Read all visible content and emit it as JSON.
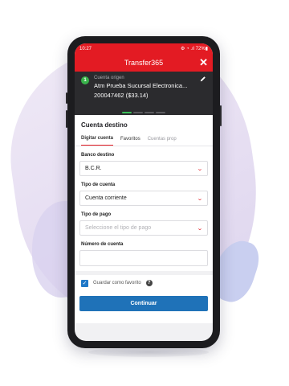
{
  "status_bar": {
    "time": "10:27",
    "icons": "⚙ ◔ .ıl 72%▮"
  },
  "header": {
    "title": "Transfer365",
    "close_label": "✕"
  },
  "origin": {
    "step_number": "1",
    "label": "Cuenta origen",
    "account_name": "Atm Prueba Sucursal Electronica...",
    "account_number": "200047462 ($33.14)"
  },
  "destination": {
    "section_title": "Cuenta destino",
    "tabs": [
      {
        "label": "Digitar cuenta"
      },
      {
        "label": "Favoritos"
      },
      {
        "label": "Cuentas prop"
      }
    ]
  },
  "form": {
    "bank": {
      "label": "Banco destino",
      "value": "B.C.R."
    },
    "account_type": {
      "label": "Tipo de cuenta",
      "value": "Cuenta corriente"
    },
    "payment_type": {
      "label": "Tipo de pago",
      "placeholder": "Seleccione el tipo de pago"
    },
    "account_number": {
      "label": "Número de cuenta",
      "value": ""
    }
  },
  "favorite": {
    "label": "Guardar como favorito",
    "checked": true,
    "help_icon": "?"
  },
  "footer": {
    "continue_label": "Continuar"
  },
  "colors": {
    "brand_red": "#e31b23",
    "action_blue": "#1f72b8",
    "dark_panel": "#2b2b2e",
    "success_green": "#38b24a"
  }
}
